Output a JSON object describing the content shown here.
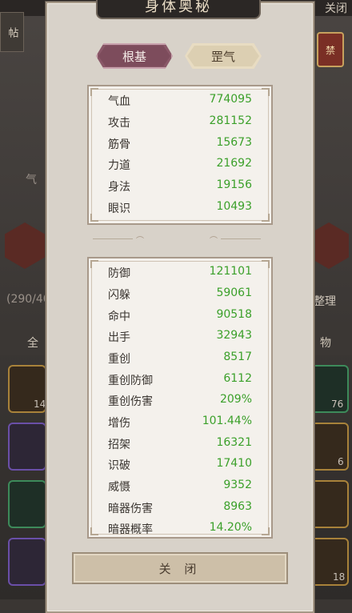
{
  "background": {
    "top_close": "关闭",
    "left_tab": "帖",
    "right_badge": "禁",
    "stat_partial": "气",
    "count_partial": "(290/40",
    "right_button": "整理",
    "left_filter": "全",
    "right_filter": "物",
    "slot_counts": [
      "14",
      "76",
      "6",
      "18"
    ]
  },
  "modal": {
    "title": "身体奥秘",
    "tabs": [
      {
        "label": "根基",
        "active": true
      },
      {
        "label": "罡气",
        "active": false
      }
    ],
    "base_stats": [
      {
        "label": "气血",
        "value": "774095"
      },
      {
        "label": "攻击",
        "value": "281152"
      },
      {
        "label": "筋骨",
        "value": "15673"
      },
      {
        "label": "力道",
        "value": "21692"
      },
      {
        "label": "身法",
        "value": "19156"
      },
      {
        "label": "眼识",
        "value": "10493"
      }
    ],
    "combat_stats": [
      {
        "label": "防御",
        "value": "121101"
      },
      {
        "label": "闪躲",
        "value": "59061"
      },
      {
        "label": "命中",
        "value": "90518"
      },
      {
        "label": "出手",
        "value": "32943"
      },
      {
        "label": "重创",
        "value": "8517"
      },
      {
        "label": "重创防御",
        "value": "6112"
      },
      {
        "label": "重创伤害",
        "value": "209%"
      },
      {
        "label": "增伤",
        "value": "101.44%"
      },
      {
        "label": "招架",
        "value": "16321"
      },
      {
        "label": "识破",
        "value": "17410"
      },
      {
        "label": "威慑",
        "value": "9352"
      },
      {
        "label": "暗器伤害",
        "value": "8963"
      },
      {
        "label": "暗器概率",
        "value": "14.20%"
      }
    ],
    "close_label": "关 闭"
  },
  "colors": {
    "value_green": "#3ba02a",
    "active_tab": "#8a5868",
    "panel_bg": "#f4f1ec"
  }
}
